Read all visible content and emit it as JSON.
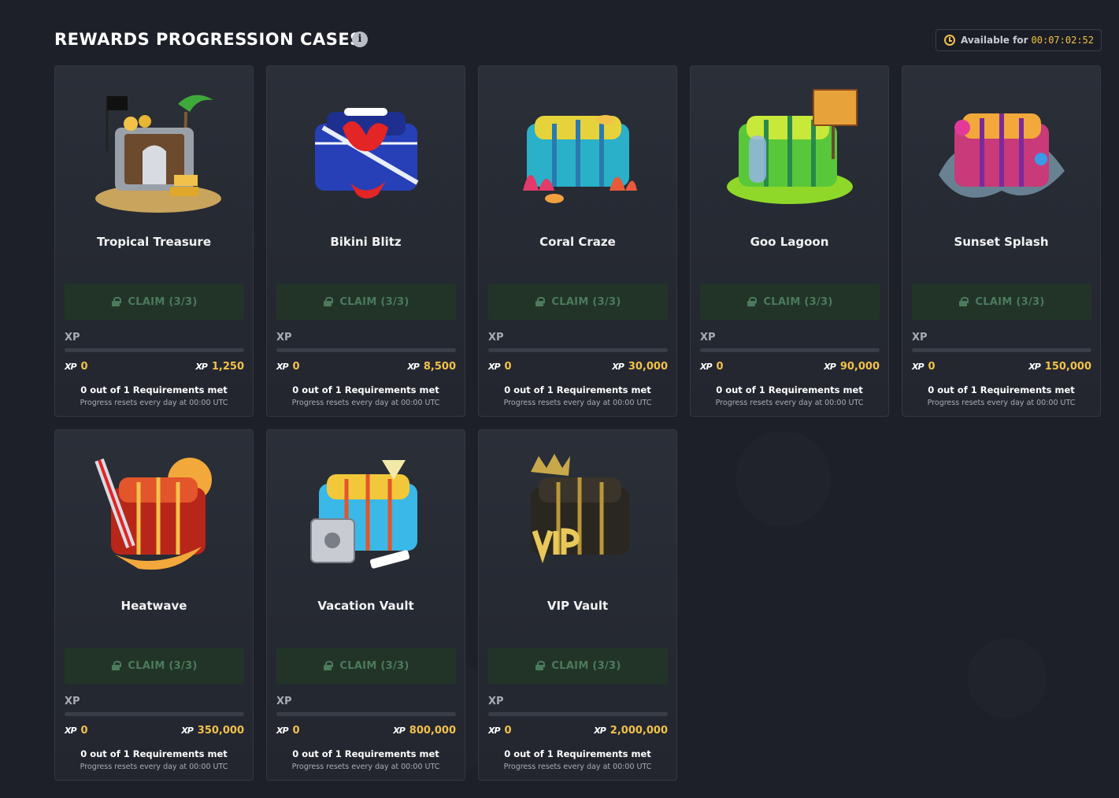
{
  "header": {
    "title": "REWARDS PROGRESSION CASES",
    "info_icon": "info-icon",
    "timer_label": "Available for",
    "timer_value": "00:07:02:52",
    "accent_color": "#f2c14a"
  },
  "common": {
    "claim_label": "CLAIM (3/3)",
    "xp_label": "XP",
    "xp_icon": "XP",
    "requirements": "0 out of 1 Requirements met",
    "reset_note": "Progress resets every day at 00:00 UTC"
  },
  "cases": [
    {
      "name": "Tropical Treasure",
      "xp_current": "0",
      "xp_target": "1,250",
      "progress": 0,
      "art": "tropical"
    },
    {
      "name": "Bikini Blitz",
      "xp_current": "0",
      "xp_target": "8,500",
      "progress": 0,
      "art": "bikini"
    },
    {
      "name": "Coral Craze",
      "xp_current": "0",
      "xp_target": "30,000",
      "progress": 0,
      "art": "coral"
    },
    {
      "name": "Goo Lagoon",
      "xp_current": "0",
      "xp_target": "90,000",
      "progress": 0,
      "art": "goo"
    },
    {
      "name": "Sunset Splash",
      "xp_current": "0",
      "xp_target": "150,000",
      "progress": 0,
      "art": "sunset"
    },
    {
      "name": "Heatwave",
      "xp_current": "0",
      "xp_target": "350,000",
      "progress": 0,
      "art": "heat"
    },
    {
      "name": "Vacation Vault",
      "xp_current": "0",
      "xp_target": "800,000",
      "progress": 0,
      "art": "vacation"
    },
    {
      "name": "VIP Vault",
      "xp_current": "0",
      "xp_target": "2,000,000",
      "progress": 0,
      "art": "vip"
    }
  ]
}
